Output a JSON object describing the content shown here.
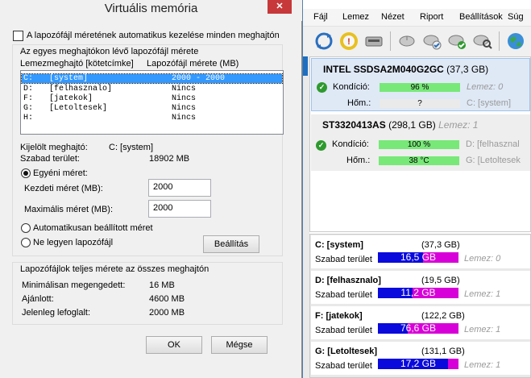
{
  "dialog": {
    "title": "Virtuális memória",
    "close_glyph": "✕",
    "auto_manage_label": "A lapozófájl méretének automatikus kezelése minden meghajtón",
    "auto_manage_checked": false,
    "group1_title": "Az egyes meghajtókon lévő lapozófájl mérete",
    "list_header_drive": "Lemezmeghajtó [kötetcímke]",
    "list_header_size": "Lapozófájl mérete (MB)",
    "list_rows": [
      {
        "drive": "C:",
        "label": "[system]",
        "size": "2000 - 2000",
        "selected": true
      },
      {
        "drive": "D:",
        "label": "[felhasznalo]",
        "size": "Nincs"
      },
      {
        "drive": "F:",
        "label": "[jatekok]",
        "size": "Nincs"
      },
      {
        "drive": "G:",
        "label": "[Letoltesek]",
        "size": "Nincs"
      },
      {
        "drive": "H:",
        "label": "",
        "size": "Nincs"
      }
    ],
    "selected_drive_label": "Kijelölt meghajtó:",
    "selected_drive_value": "C:  [system]",
    "free_space_label": "Szabad terület:",
    "free_space_value": "18902  MB",
    "custom_size_label": "Egyéni méret:",
    "initial_size_label": "Kezdeti méret (MB):",
    "initial_size_value": "2000",
    "max_size_label": "Maximális méret (MB):",
    "max_size_value": "2000",
    "system_managed_label": "Automatikusan beállított méret",
    "no_paging_label": "Ne legyen lapozófájl",
    "set_button": "Beállítás",
    "group2_title": "Lapozófájlok teljes mérete az összes meghajtón",
    "min_allowed_label": "Minimálisan megengedett:",
    "min_allowed_value": "16  MB",
    "recommended_label": "Ajánlott:",
    "recommended_value": "4600  MB",
    "allocated_label": "Jelenleg lefoglalt:",
    "allocated_value": "2000  MB",
    "ok_button": "OK",
    "cancel_button": "Mégse"
  },
  "app": {
    "menu": [
      "Fájl",
      "Lemez",
      "Nézet",
      "Riport",
      "Beállítások",
      "Súg"
    ],
    "toolbar_icons": [
      "refresh-icon",
      "warning-icon",
      "disk-icon",
      "mouse-icon",
      "disk-check-icon",
      "disk-ok-icon",
      "disk-search-icon",
      "globe-icon"
    ],
    "drives": [
      {
        "title_bold": "INTEL SSDSA2M040G2GC",
        "title_size": " (37,3 GB)",
        "extra": "",
        "health_label": "Kondíció:",
        "health_value": "96 %",
        "health_percent": 96,
        "temp_label": "Hőm.:",
        "temp_value": "?",
        "lemez_label": "Lemez: 0",
        "volume_label": "C: [system]"
      },
      {
        "title_bold": "ST3320413AS",
        "title_size": " (298,1 GB)",
        "extra": "Lemez: 1",
        "health_label": "Kondíció:",
        "health_value": "100 %",
        "health_percent": 100,
        "temp_label": "Hőm.:",
        "temp_value": "38 °C",
        "lemez_label": "D: [felhasznal",
        "volume_label": "G: [Letoltesek"
      }
    ],
    "volumes": [
      {
        "name": "C: [system]",
        "size": "(37,3 GB)",
        "free_label": "Szabad terület",
        "free_value": "16,5 GB",
        "used_fraction": 0.56,
        "disk_label": "Lemez: 0"
      },
      {
        "name": "D: [felhasznalo]",
        "size": "(19,5 GB)",
        "free_label": "Szabad terület",
        "free_value": "11,2 GB",
        "used_fraction": 0.43,
        "disk_label": "Lemez: 1"
      },
      {
        "name": "F: [jatekok]",
        "size": "(122,2 GB)",
        "free_label": "Szabad terület",
        "free_value": "76,6 GB",
        "used_fraction": 0.37,
        "disk_label": "Lemez: 1"
      },
      {
        "name": "G: [Letoltesek]",
        "size": "(131,1 GB)",
        "free_label": "Szabad terület",
        "free_value": "17,2 GB",
        "used_fraction": 0.87,
        "disk_label": "Lemez: 1"
      }
    ]
  }
}
